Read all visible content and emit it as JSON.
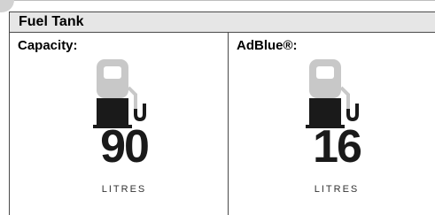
{
  "header": {
    "title": "Fuel Tank"
  },
  "cells": [
    {
      "label": "Capacity:",
      "value": "90",
      "unit": "LITRES",
      "icon": "fuel-pump-icon"
    },
    {
      "label": "AdBlue®:",
      "value": "16",
      "unit": "LITRES",
      "icon": "fuel-pump-icon"
    }
  ],
  "colors": {
    "header_bg": "#e6e6e6",
    "pump_light": "#c8c8c8",
    "pump_dark": "#1a1a1a"
  }
}
